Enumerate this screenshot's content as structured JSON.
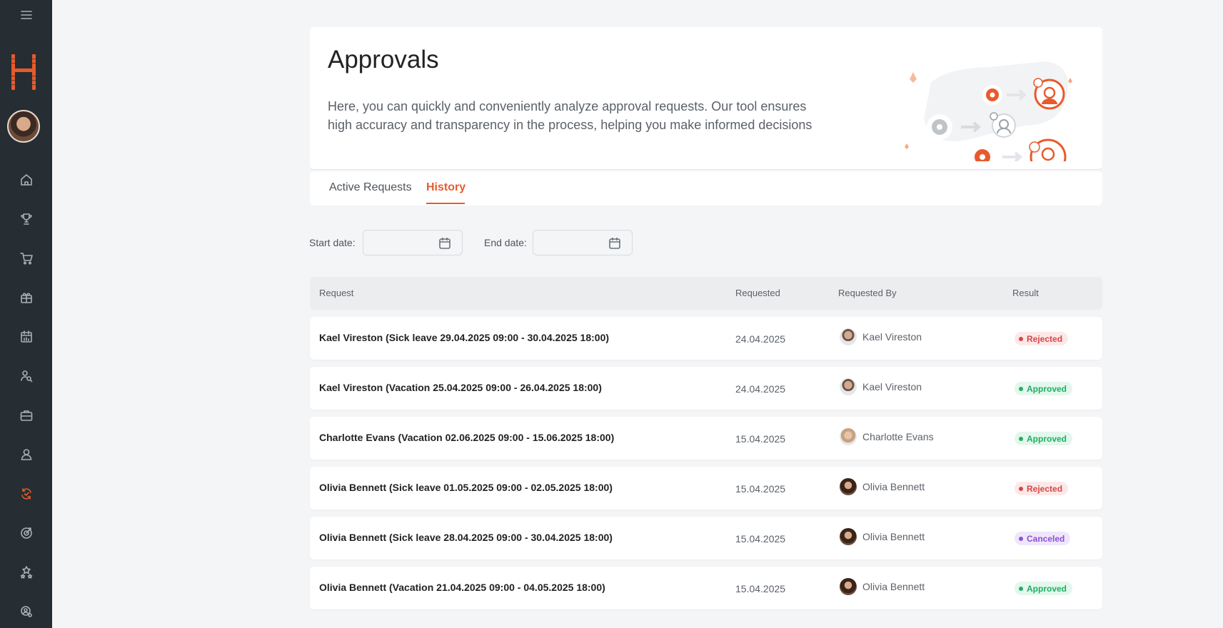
{
  "page": {
    "title": "Approvals",
    "description": "Here, you can quickly and conveniently analyze approval requests. Our tool ensures high accuracy and transparency in the process, helping you make informed decisions"
  },
  "tabs": [
    {
      "label": "Active Requests",
      "active": false
    },
    {
      "label": "History",
      "active": true
    }
  ],
  "filters": {
    "start_label": "Start date:",
    "end_label": "End date:",
    "start_value": "",
    "end_value": ""
  },
  "table": {
    "headers": [
      "Request",
      "Requested",
      "Requested By",
      "Result"
    ],
    "rows": [
      {
        "request": "Kael Vireston (Sick leave 29.04.2025 09:00 - 30.04.2025 18:00)",
        "requested": "24.04.2025",
        "by": "Kael Vireston",
        "result": "Rejected",
        "avatar": "male"
      },
      {
        "request": "Kael Vireston (Vacation 25.04.2025 09:00 - 26.04.2025 18:00)",
        "requested": "24.04.2025",
        "by": "Kael Vireston",
        "result": "Approved",
        "avatar": "male"
      },
      {
        "request": "Charlotte Evans (Vacation 02.06.2025 09:00 - 15.06.2025 18:00)",
        "requested": "15.04.2025",
        "by": "Charlotte Evans",
        "result": "Approved",
        "avatar": "female-light"
      },
      {
        "request": "Olivia Bennett (Sick leave 01.05.2025 09:00 - 02.05.2025 18:00)",
        "requested": "15.04.2025",
        "by": "Olivia Bennett",
        "result": "Rejected",
        "avatar": "female-dark"
      },
      {
        "request": "Olivia Bennett (Sick leave 28.04.2025 09:00 - 30.04.2025 18:00)",
        "requested": "15.04.2025",
        "by": "Olivia Bennett",
        "result": "Canceled",
        "avatar": "female-dark"
      },
      {
        "request": "Olivia Bennett (Vacation 21.04.2025 09:00 - 04.05.2025 18:00)",
        "requested": "15.04.2025",
        "by": "Olivia Bennett",
        "result": "Approved",
        "avatar": "female-dark"
      }
    ]
  },
  "status_colors": {
    "Rejected": {
      "bg": "#fde8e8",
      "fg": "#d64545"
    },
    "Approved": {
      "bg": "#e3f7ec",
      "fg": "#1fae63"
    },
    "Canceled": {
      "bg": "#efe6fb",
      "fg": "#8c4fd6"
    }
  },
  "colors": {
    "accent": "#e85a2c",
    "sidebar": "#262d33"
  },
  "sidebar": {
    "icons": [
      "menu-icon",
      "home-icon",
      "trophy-icon",
      "cart-icon",
      "gift-icon",
      "calendar-chart-icon",
      "people-search-icon",
      "briefcase-icon",
      "user-icon",
      "approvals-icon",
      "target-icon",
      "stars-icon",
      "settings-user-icon"
    ]
  }
}
